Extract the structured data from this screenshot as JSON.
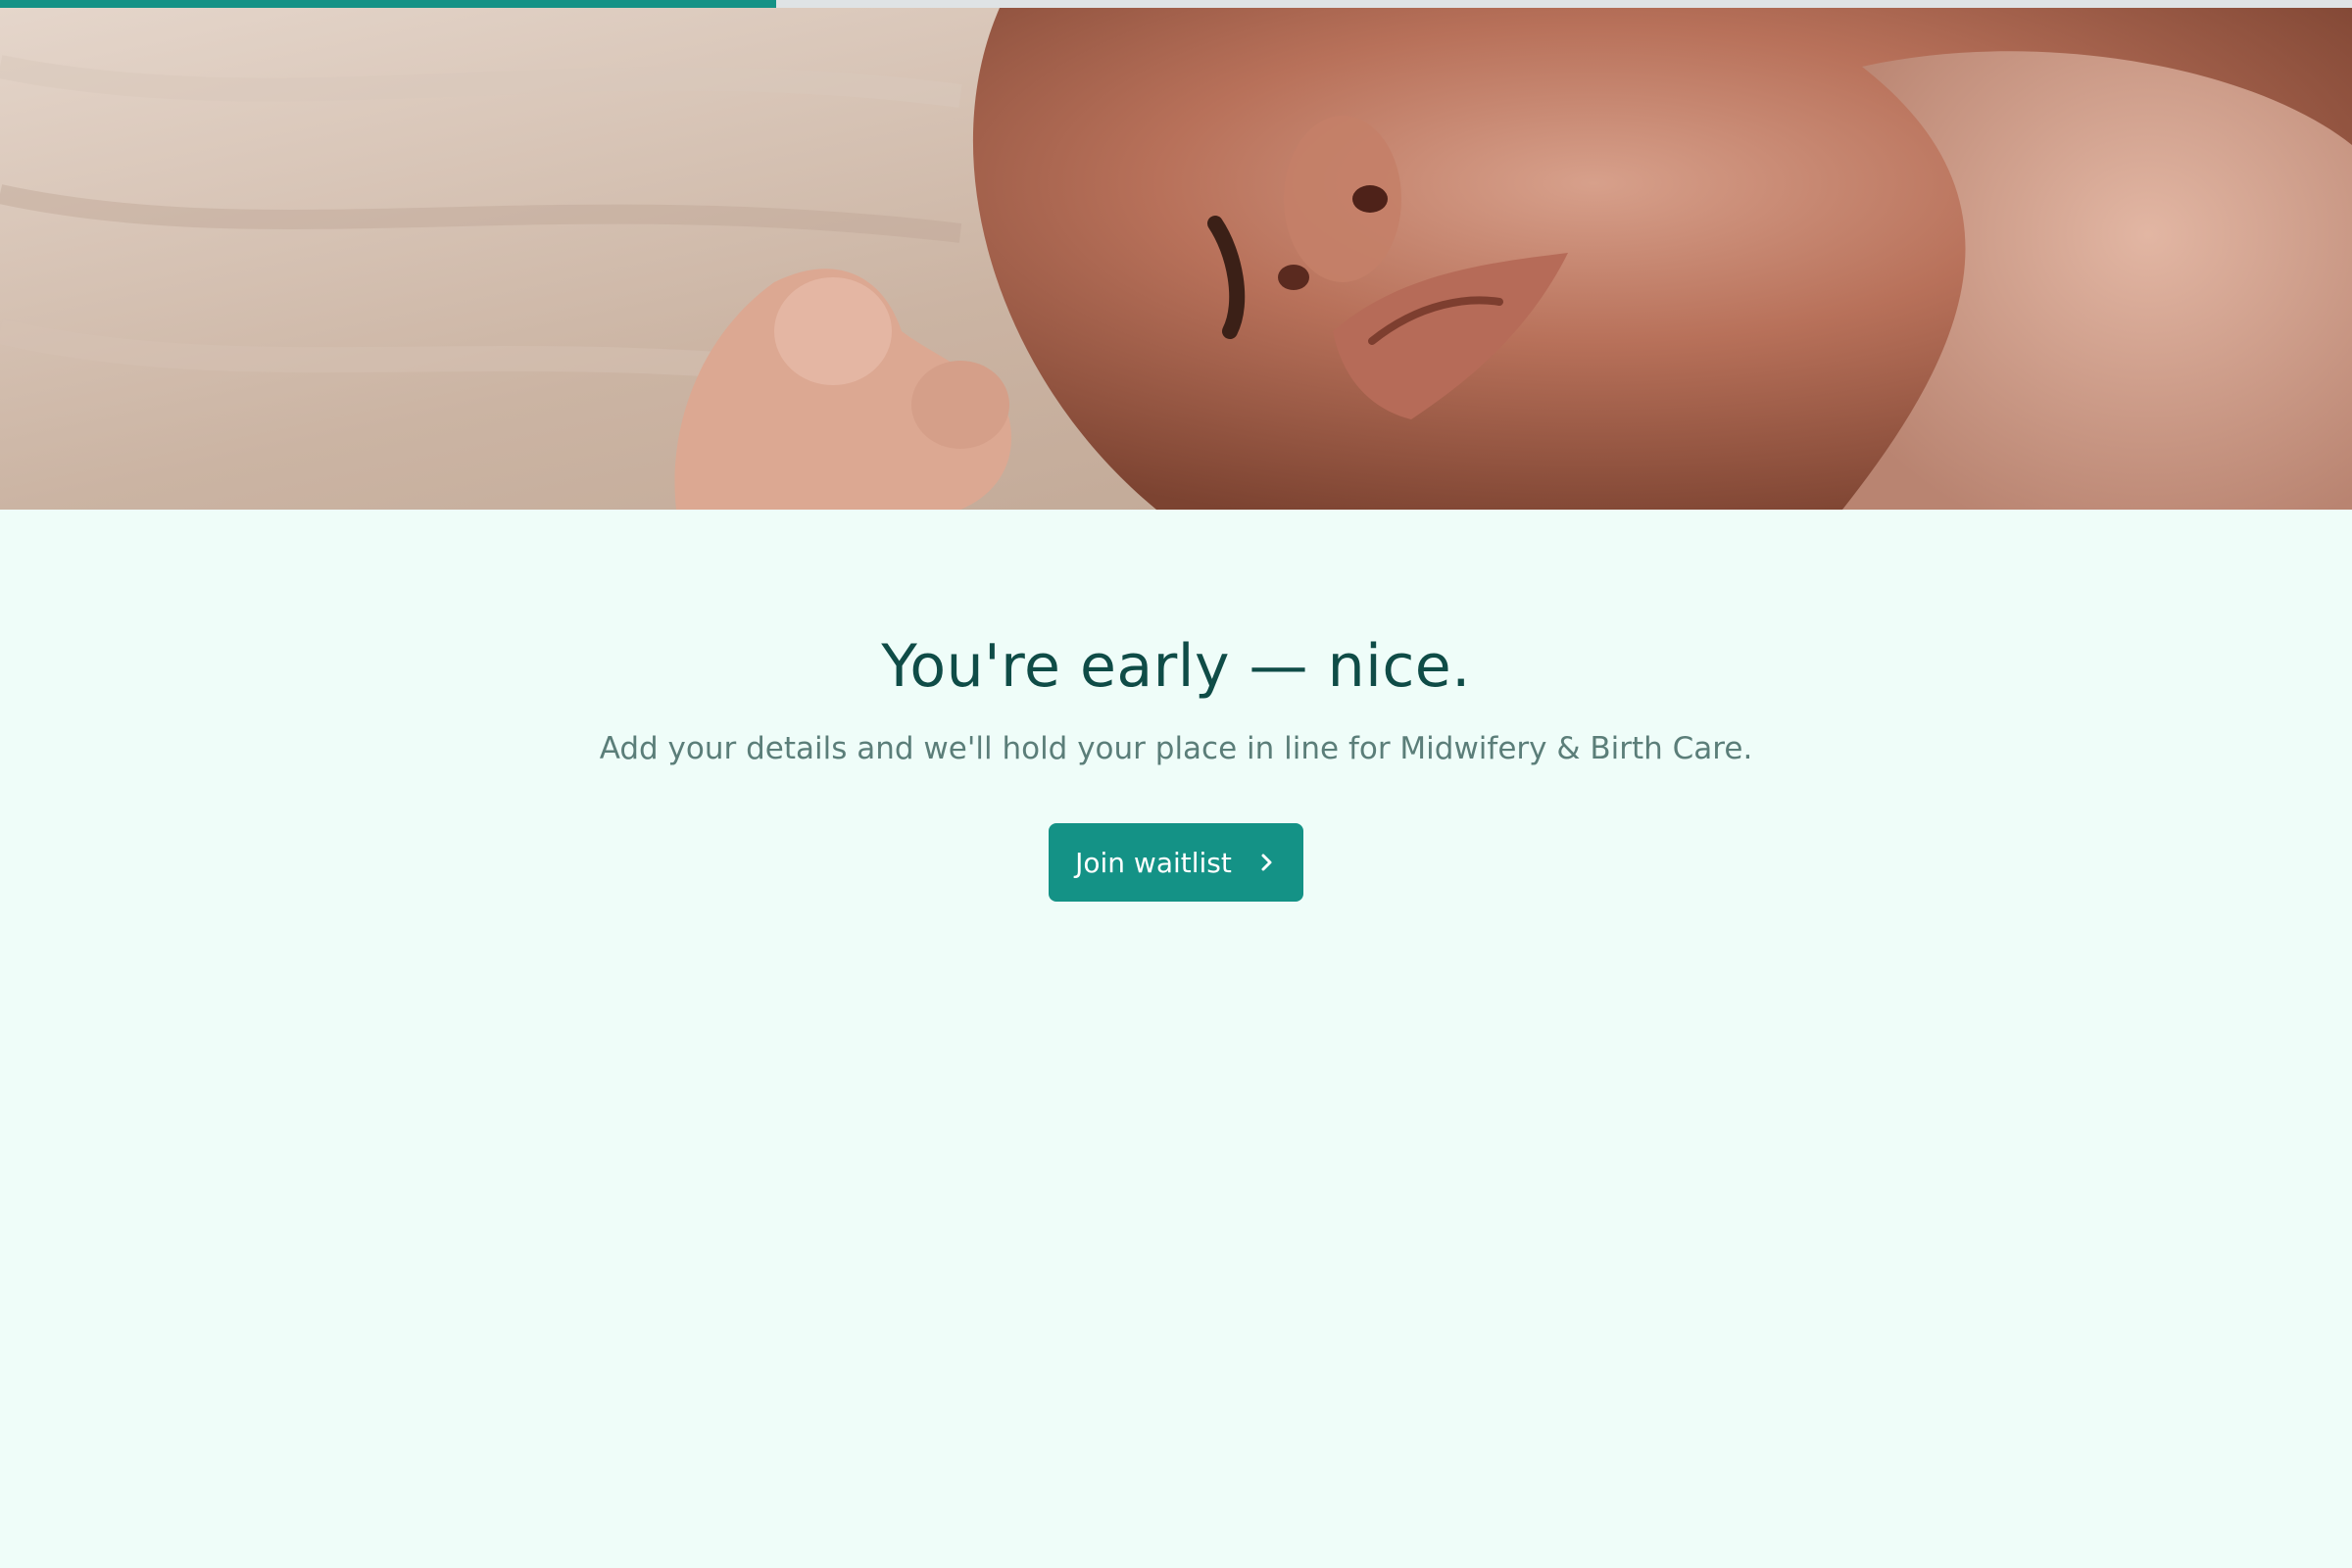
{
  "progress": {
    "fraction": 0.33,
    "color": "#149286",
    "track_color": "#dfe3e5"
  },
  "hero": {
    "image": "newborn-baby-photo"
  },
  "main": {
    "headline": "You're early — nice.",
    "subtitle": "Add your details and we'll hold your place in line for Midwifery & Birth Care.",
    "cta_label": "Join waitlist",
    "cta_icon": "chevron-right-icon"
  },
  "colors": {
    "background": "#effdf9",
    "accent": "#149286",
    "headline": "#0f4c47",
    "subtitle": "#5b7e79"
  }
}
